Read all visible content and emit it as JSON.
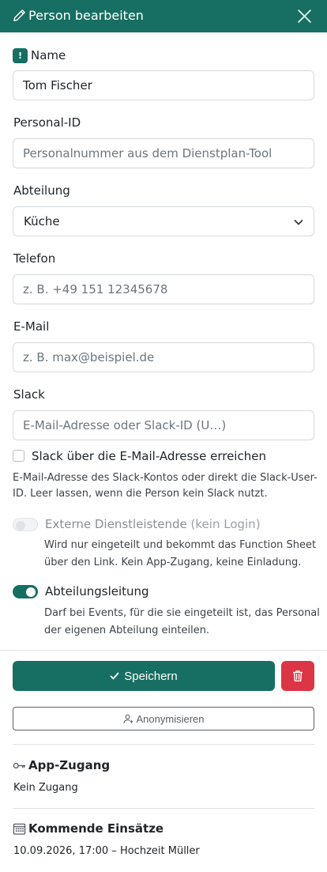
{
  "header": {
    "title": "Person bearbeiten",
    "color": "#176e62"
  },
  "form": {
    "name": {
      "label": "Name",
      "required_badge": "!",
      "value": "Tom Fischer"
    },
    "personal_id": {
      "label": "Personal-ID",
      "placeholder": "Personalnummer aus dem Dienstplan-Tool"
    },
    "department": {
      "label": "Abteilung",
      "value": "Küche"
    },
    "phone": {
      "label": "Telefon",
      "placeholder": "z. B. +49 151 12345678"
    },
    "email": {
      "label": "E-Mail",
      "placeholder": "z. B. max@beispiel.de"
    },
    "slack": {
      "label": "Slack",
      "placeholder": "E-Mail-Adresse oder Slack-ID (U…)",
      "checkbox_label": "Slack über die E-Mail-Adresse erreichen",
      "checked": false,
      "help_line1": "E-Mail-Adresse des Slack-Kontos oder direkt die Slack-User-",
      "help_line2": "ID. Leer lassen, wenn die Person kein Slack nutzt."
    },
    "external": {
      "label": "Externe Dienstleistende",
      "label_suffix": "(kein Login)",
      "enabled": false,
      "disabled": true,
      "help_line1": "Wird nur eingeteilt und bekommt das Function Sheet",
      "help_line2": "über den Link. Kein App-Zugang, keine Einladung."
    },
    "department_lead": {
      "label": "Abteilungsleitung",
      "enabled": true,
      "help_line1": "Darf bei Events, für die sie eingeteilt ist, das Personal",
      "help_line2": "der eigenen Abteilung einteilen."
    }
  },
  "actions": {
    "save_label": "Speichern",
    "anonymize_label": "Anonymisieren",
    "save_color": "#176e62",
    "delete_color": "#dc3545"
  },
  "app_access": {
    "title": "App-Zugang",
    "status": "Kein Zugang",
    "icon": "key-icon"
  },
  "upcoming": {
    "title": "Kommende Einsätze",
    "icon": "calendar-icon",
    "items": [
      {
        "datetime": "10.09.2026, 17:00",
        "separator": "–",
        "event": "Hochzeit Müller"
      }
    ]
  }
}
